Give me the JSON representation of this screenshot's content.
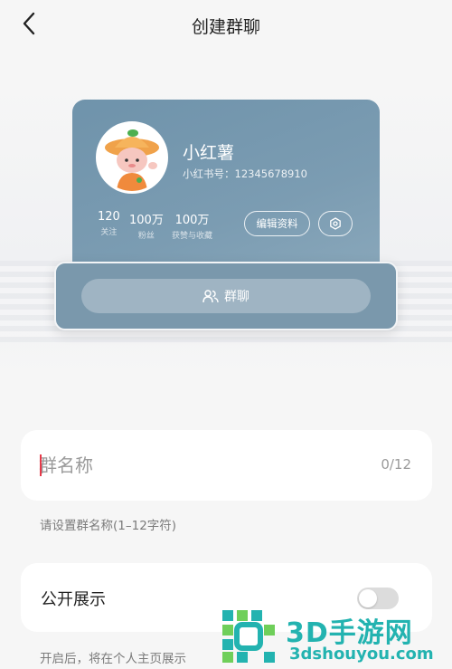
{
  "header": {
    "title": "创建群聊"
  },
  "profile_preview": {
    "nickname": "小红薯",
    "user_id": "小红书号：12345678910",
    "stats": [
      {
        "value": "120",
        "label": "关注"
      },
      {
        "value": "100万",
        "label": "粉丝"
      },
      {
        "value": "100万",
        "label": "获赞与收藏"
      }
    ],
    "edit_profile_label": "编辑资料",
    "group_chat_label": "群聊"
  },
  "form": {
    "group_name": {
      "placeholder": "群名称",
      "value": "",
      "counter": "0/12",
      "hint": "请设置群名称(1–12字符)"
    },
    "public_display": {
      "label": "公开展示",
      "enabled": false,
      "hint": "开启后，将在个人主页展示"
    }
  },
  "watermark": {
    "brand": "3D手游网",
    "url": "3dshouyou.com"
  },
  "colors": {
    "card_blue": "#7396ae",
    "accent_red": "#e63a4a",
    "watermark_teal": "#23b3b0"
  }
}
